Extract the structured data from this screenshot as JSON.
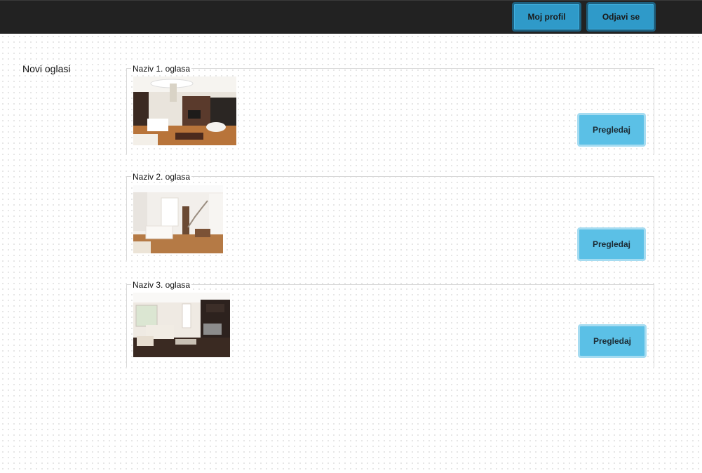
{
  "header": {
    "profile_label": "Moj profil",
    "logout_label": "Odjavi se"
  },
  "sidebar": {
    "title": "Novi oglasi"
  },
  "listings": [
    {
      "title": "Naziv 1. oglasa",
      "button_label": "Pregledaj",
      "image": "living-room-photo"
    },
    {
      "title": "Naziv 2. oglasa",
      "button_label": "Pregledaj",
      "image": "living-room-photo"
    },
    {
      "title": "Naziv 3. oglasa",
      "button_label": "Pregledaj",
      "image": "living-room-photo"
    }
  ],
  "colors": {
    "topbar": "#222222",
    "nav_button": "#2f9ac9",
    "view_button": "#5bc0e6"
  }
}
